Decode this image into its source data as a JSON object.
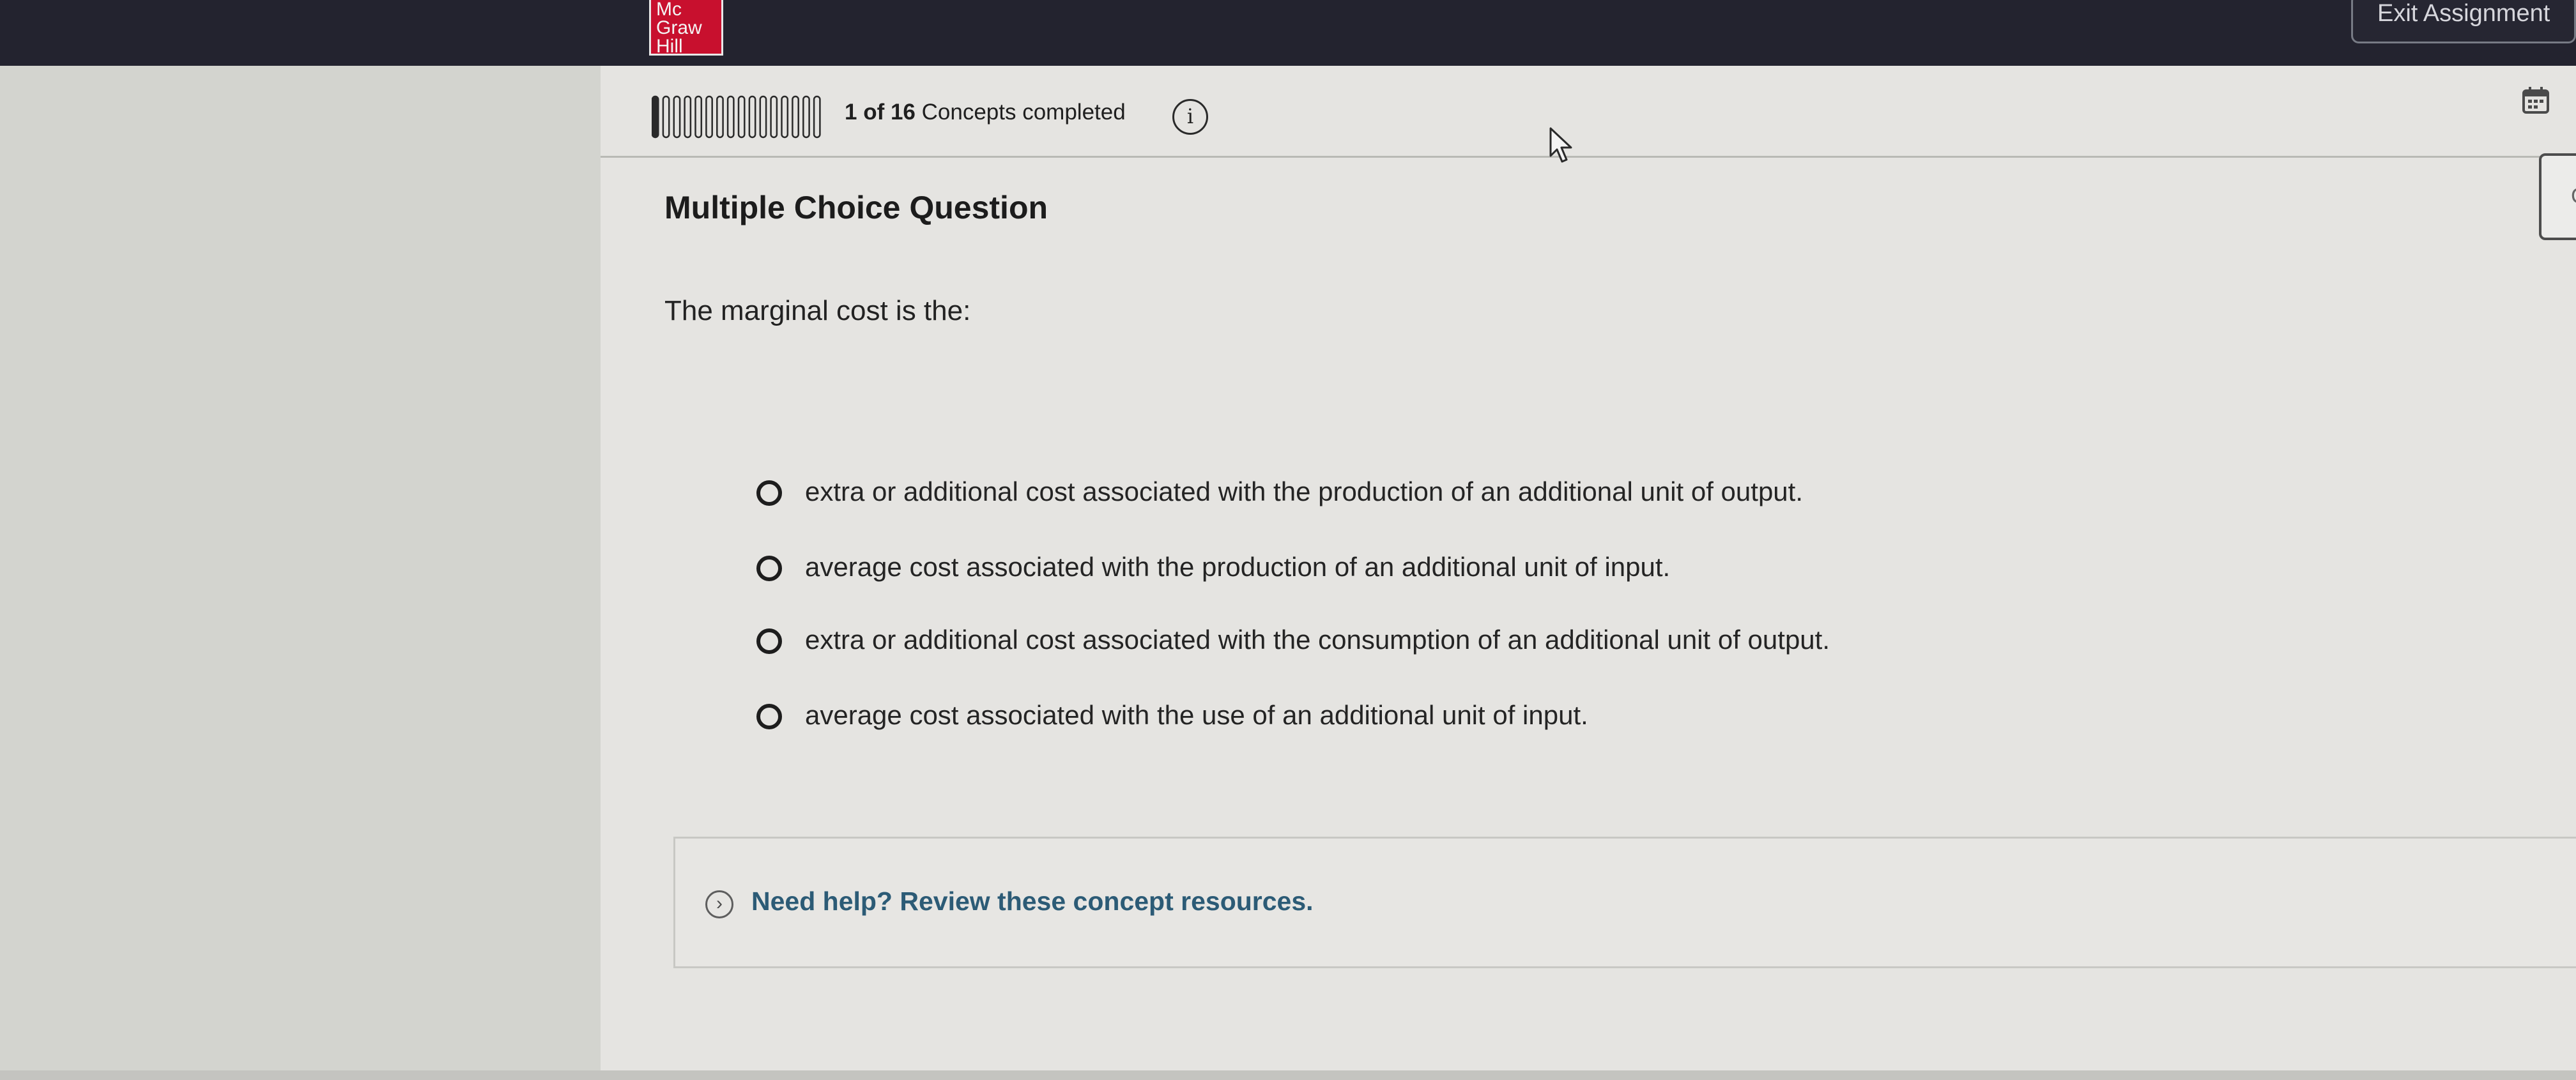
{
  "header": {
    "logo": [
      "Mc",
      "Graw",
      "Hill"
    ],
    "exit_label": "Exit Assignment"
  },
  "progress": {
    "count_text": "1 of 16",
    "label": "Concepts completed",
    "completed": 1,
    "total": 16,
    "info_icon": "i"
  },
  "question": {
    "type": "Multiple Choice Question",
    "prompt": "The marginal cost is the:",
    "options": [
      "extra or additional cost associated with the production of an additional unit of output.",
      "average cost associated with the production of an additional unit of input.",
      "extra or additional cost associated with the consumption of an additional unit of output.",
      "average cost associated with the use of an additional unit of input."
    ],
    "selected": null
  },
  "help": {
    "chevron_icon": "›",
    "label": "Need help? Review these concept resources."
  },
  "side_tab": {
    "label": "C"
  },
  "icons": {
    "calendar": "calendar-icon",
    "cursor": "mouse-pointer-icon"
  },
  "colors": {
    "topbar": "#23232f",
    "brand_red": "#c8102e",
    "link_blue": "#2c5b76"
  }
}
